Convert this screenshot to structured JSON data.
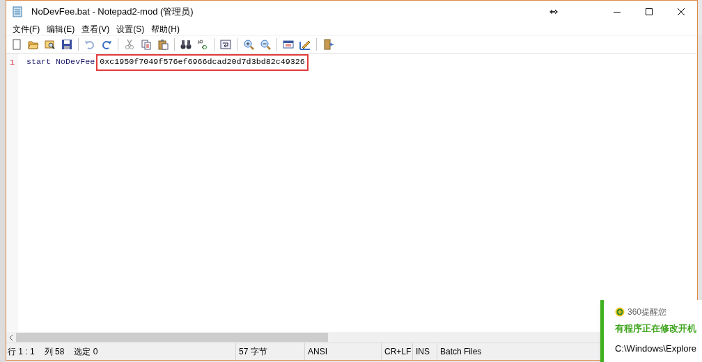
{
  "window": {
    "title": "NoDevFee.bat - Notepad2-mod (管理员)"
  },
  "menu": [
    {
      "label": "文件(F)"
    },
    {
      "label": "编辑(E)"
    },
    {
      "label": "查看(V)"
    },
    {
      "label": "设置(S)"
    },
    {
      "label": "帮助(H)"
    }
  ],
  "editor": {
    "lines": [
      {
        "number": "1",
        "segments": [
          {
            "text": "start NoDevFee",
            "boxed": false
          },
          {
            "text": "0xc1950f7049f576ef6966dcad20d7d3bd82c49326",
            "boxed": true
          }
        ]
      }
    ]
  },
  "status_bar": {
    "position": [
      "行 1 : 1",
      "列 58",
      "选定 0"
    ],
    "segments": [
      "57 字节",
      "ANSI",
      "CR+LF",
      "INS",
      "Batch Files"
    ]
  },
  "notification": {
    "title": "360提醒您",
    "headline": "有程序正在修改开机",
    "path": "C:\\Windows\\Explore"
  }
}
